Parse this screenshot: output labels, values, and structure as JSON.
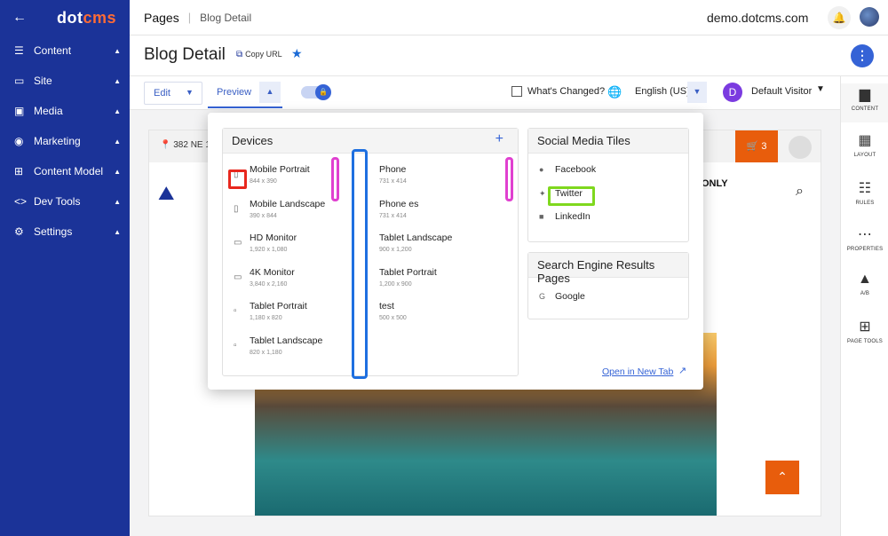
{
  "app": {
    "logo_main": "dot",
    "logo_accent": "cms",
    "back_icon": "arrow-left-icon"
  },
  "sidebar": {
    "items": [
      {
        "label": "Content",
        "icon": "list-icon"
      },
      {
        "label": "Site",
        "icon": "folder-icon"
      },
      {
        "label": "Media",
        "icon": "image-icon"
      },
      {
        "label": "Marketing",
        "icon": "target-icon"
      },
      {
        "label": "Content Model",
        "icon": "grid-icon"
      },
      {
        "label": "Dev Tools",
        "icon": "code-icon"
      },
      {
        "label": "Settings",
        "icon": "gear-icon"
      }
    ]
  },
  "topbar": {
    "pages": "Pages",
    "crumb": "Blog Detail",
    "host": "demo.dotcms.com"
  },
  "titlebar": {
    "title": "Blog Detail",
    "copy_url": "Copy URL"
  },
  "toolbar": {
    "edit": "Edit",
    "preview": "Preview",
    "whats_changed": "What's Changed?",
    "language": "English (US)",
    "visitor_initial": "D",
    "visitor": "Default Visitor"
  },
  "right_panel": {
    "items": [
      {
        "label": "CONTENT",
        "icon": "document-icon"
      },
      {
        "label": "LAYOUT",
        "icon": "layout-icon"
      },
      {
        "label": "RULES",
        "icon": "sliders-icon"
      },
      {
        "label": "PROPERTIES",
        "icon": "dots-icon"
      },
      {
        "label": "A/B",
        "icon": "flask-icon"
      },
      {
        "label": "PAGE TOOLS",
        "icon": "tools-icon"
      }
    ]
  },
  "page_preview": {
    "address": "382 NE 1",
    "cart_count": "3",
    "banner_text": "ONLY"
  },
  "preview_menu": {
    "devices_title": "Devices",
    "devices_left": [
      {
        "name": "Mobile Portrait",
        "size": "844 x 390"
      },
      {
        "name": "Mobile Landscape",
        "size": "390 x 844"
      },
      {
        "name": "HD Monitor",
        "size": "1,920 x 1,080"
      },
      {
        "name": "4K Monitor",
        "size": "3,840 x 2,160"
      },
      {
        "name": "Tablet Portrait",
        "size": "1,180 x 820"
      },
      {
        "name": "Tablet Landscape",
        "size": "820 x 1,180"
      }
    ],
    "devices_right": [
      {
        "name": "Phone",
        "size": "731 x 414"
      },
      {
        "name": "Phone es",
        "size": "731 x 414"
      },
      {
        "name": "Tablet Landscape",
        "size": "900 x 1,200"
      },
      {
        "name": "Tablet Portrait",
        "size": "1,200 x 900"
      },
      {
        "name": "test",
        "size": "500 x 500"
      }
    ],
    "social_title": "Social Media Tiles",
    "social": [
      {
        "name": "Facebook",
        "icon": "facebook-icon"
      },
      {
        "name": "Twitter",
        "icon": "twitter-icon"
      },
      {
        "name": "LinkedIn",
        "icon": "linkedin-icon"
      }
    ],
    "seo_title": "Search Engine Results Pages",
    "seo": [
      {
        "name": "Google",
        "icon": "google-icon"
      }
    ],
    "open_new_tab": "Open in New Tab"
  },
  "colors": {
    "sidebar": "#1b3398",
    "accent": "#3563d6",
    "orange": "#e85d0c"
  }
}
